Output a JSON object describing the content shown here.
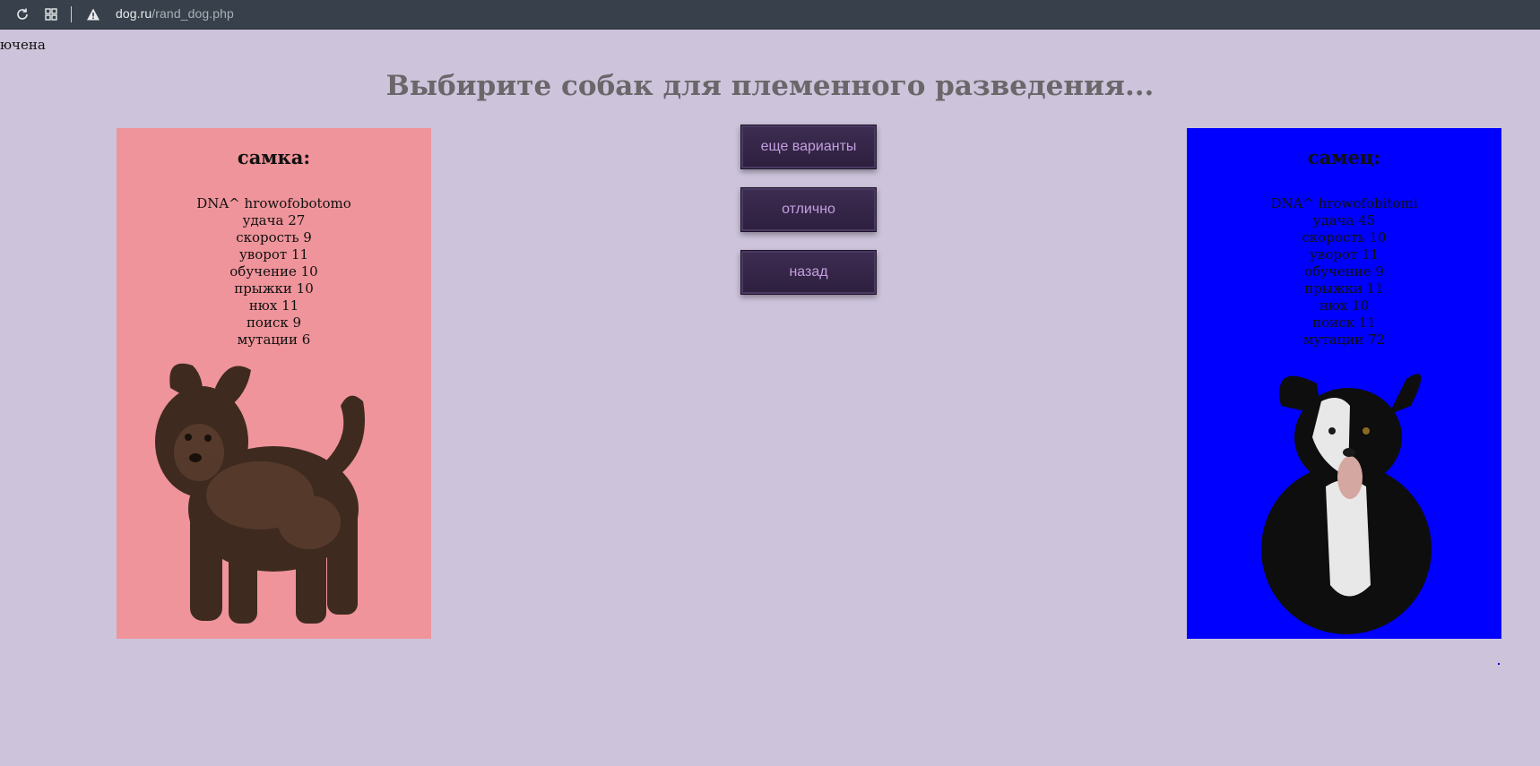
{
  "browser": {
    "url_domain": "dog.ru",
    "url_path": "/rand_dog.php"
  },
  "corner_text": "ючена",
  "page": {
    "title": "Выбирите собак для племенного разведения..."
  },
  "female": {
    "heading": "самка:",
    "stats": [
      "DNA^ hrowofobotomo",
      "удача 27",
      "скорость 9",
      "уворот 11",
      "обучение 10",
      "прыжки 10",
      "нюх 11",
      "поиск 9",
      "мутации 6"
    ],
    "bg_color": "#ef949a"
  },
  "male": {
    "heading": "самец:",
    "stats": [
      "DNA^ hrowofobitomi",
      "удача 45",
      "скорость 10",
      "уворот 11",
      "обучение 9",
      "прыжки 11",
      "нюх 10",
      "поиск 11",
      "мутации 72"
    ],
    "bg_color": "#0000ff"
  },
  "buttons": {
    "more": "еще варианты",
    "ok": "отлично",
    "back": "назад"
  },
  "icons": [
    "reload-icon",
    "tabs-grid-icon",
    "not-secure-warning-icon"
  ]
}
